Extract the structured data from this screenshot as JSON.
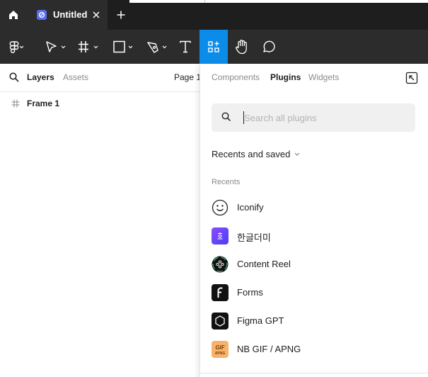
{
  "tabbar": {
    "home_icon": "home-icon",
    "tab_title": "Untitled",
    "close_icon": "close-icon",
    "new_tab_icon": "plus-icon"
  },
  "toolbar": {
    "tools": [
      {
        "name": "main-menu-tool",
        "icon": "figma-logo-icon"
      },
      {
        "name": "move-tool",
        "icon": "cursor-icon"
      },
      {
        "name": "frame-tool",
        "icon": "frame-hash-icon"
      },
      {
        "name": "shape-tool",
        "icon": "rectangle-icon"
      },
      {
        "name": "pen-tool",
        "icon": "pen-icon"
      },
      {
        "name": "text-tool",
        "icon": "text-icon"
      },
      {
        "name": "resources-tool",
        "icon": "resources-icon",
        "active": true
      },
      {
        "name": "hand-tool",
        "icon": "hand-icon"
      },
      {
        "name": "comment-tool",
        "icon": "comment-icon"
      }
    ],
    "active_color": "#0c8ce9"
  },
  "left_panel": {
    "layers_tab": "Layers",
    "assets_tab": "Assets",
    "page_label": "Page 1",
    "layers": [
      {
        "name": "Frame 1",
        "icon": "frame-hash-icon"
      }
    ]
  },
  "plugin_panel": {
    "tabs": [
      "Components",
      "Plugins",
      "Widgets"
    ],
    "active_tab": "Plugins",
    "search_placeholder": "Search all plugins",
    "filter_label": "Recents and saved",
    "section_label": "Recents",
    "plugins": [
      {
        "name": "Iconify",
        "icon": "smiley-icon"
      },
      {
        "name": "한글더미",
        "icon": "hangul-icon"
      },
      {
        "name": "Content Reel",
        "icon": "content-reel-icon"
      },
      {
        "name": "Forms",
        "icon": "forms-f-icon"
      },
      {
        "name": "Figma GPT",
        "icon": "hexagon-icon"
      },
      {
        "name": "NB GIF / APNG",
        "icon": "gif-apng-icon",
        "icon_text": "GIF APNG"
      }
    ]
  }
}
